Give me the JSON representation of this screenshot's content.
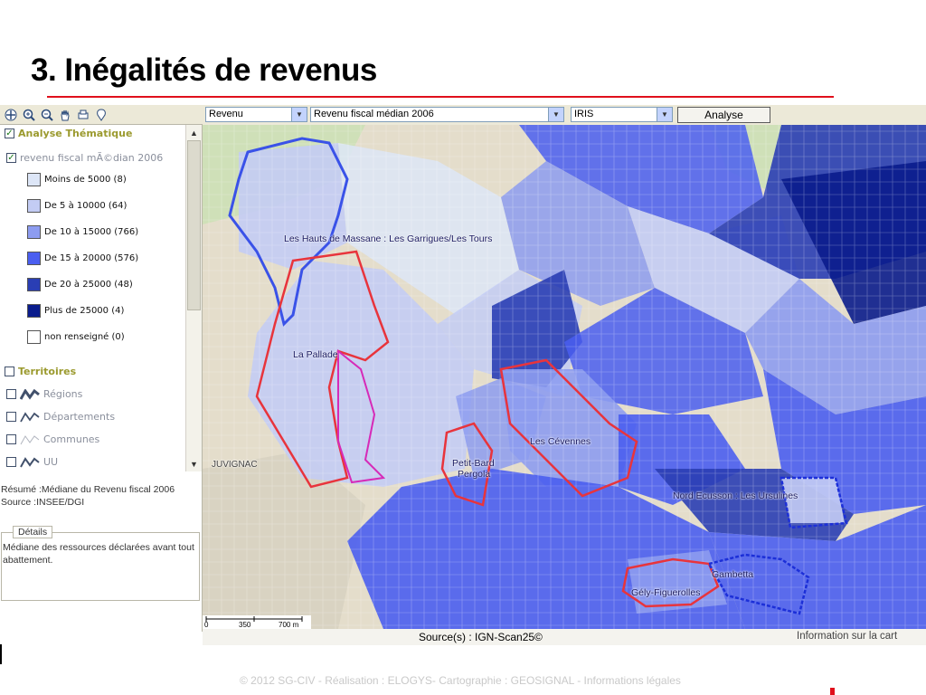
{
  "slide": {
    "title": "3. Inégalités de revenus",
    "footer": "© 2012 SG-CIV - Réalisation : ELOGYS- Cartographie : GEOSIGNAL - Informations légales"
  },
  "toolbar": {
    "icons": [
      "pan-icon",
      "zoom-in-icon",
      "zoom-out-icon",
      "hand-icon",
      "print-icon",
      "info-icon"
    ]
  },
  "controls": {
    "theme_select": "Revenu",
    "indicator_select": "Revenu fiscal médian 2006",
    "level_select": "IRIS",
    "analyse_button": "Analyse"
  },
  "layer_tree": {
    "group_analyse": "Analyse Thématique",
    "layer_revenu": "revenu fiscal mÃ©dian 2006",
    "legend": [
      {
        "label": "Moins de 5000  (8)",
        "color": "#dde6f7"
      },
      {
        "label": "De 5 à 10000  (64)",
        "color": "#c3ccf4"
      },
      {
        "label": "De 10 à 15000  (766)",
        "color": "#8d9cf0"
      },
      {
        "label": "De 15 à 20000  (576)",
        "color": "#4a5ef0"
      },
      {
        "label": "De 20 à 25000  (48)",
        "color": "#2a3eb4"
      },
      {
        "label": "Plus de 25000  (4)",
        "color": "#0a1c8c"
      },
      {
        "label": "non renseigné  (0)",
        "color": "#ffffff"
      }
    ],
    "group_territoires": "Territoires",
    "territoires": [
      "Régions",
      "Départements",
      "Communes",
      "UU"
    ]
  },
  "resume": {
    "line1": "Résumé :Médiane du Revenu fiscal 2006",
    "line2": "Source :INSEE/DGI"
  },
  "details": {
    "legend": "Détails",
    "text": "Médiane des ressources déclarées avant tout abattement."
  },
  "map": {
    "labels": [
      "Les Hauts de Massane : Les Garrigues/Les Tours",
      "La Pallade",
      "Les Cévennes",
      "Petit-Bard",
      "Pergola",
      "Nord Ecusson : Les Ursulines",
      "Gambetta",
      "Gély-Figuerolles",
      "JUVIGNAC"
    ],
    "scale": {
      "t0": "0",
      "t1": "350",
      "t2": "700 m"
    },
    "source": "Source(s) : IGN-Scan25©",
    "info": "Information sur la cart"
  }
}
